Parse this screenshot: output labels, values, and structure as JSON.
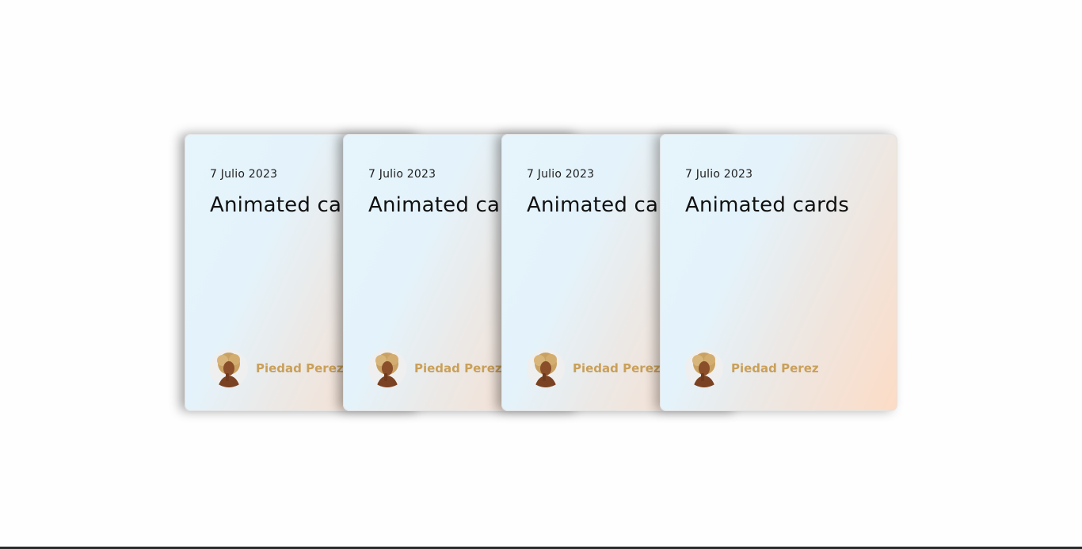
{
  "cards": [
    {
      "date": "7 Julio 2023",
      "title": "Animated cards",
      "author": "Piedad Perez"
    },
    {
      "date": "7 Julio 2023",
      "title": "Animated cards",
      "author": "Piedad Perez"
    },
    {
      "date": "7 Julio 2023",
      "title": "Animated cards",
      "author": "Piedad Perez"
    },
    {
      "date": "7 Julio 2023",
      "title": "Animated cards",
      "author": "Piedad Perez"
    }
  ],
  "colors": {
    "card_gradient_start": "#e4f3fb",
    "card_gradient_end": "#fcdcc6",
    "author_name": "#c9a05a"
  },
  "icons": {
    "avatar": "author-portrait-avatar"
  }
}
